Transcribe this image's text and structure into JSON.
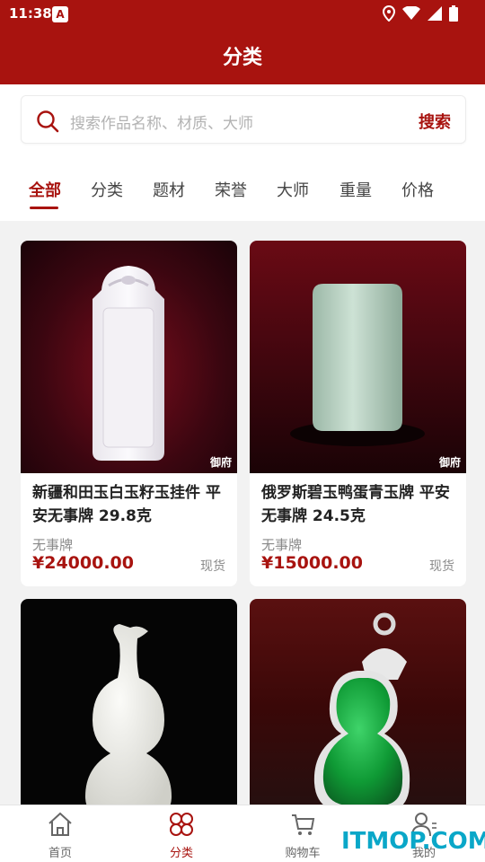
{
  "status_bar": {
    "time": "11:38",
    "app_icon_glyph": "A"
  },
  "header": {
    "title": "分类"
  },
  "search": {
    "placeholder": "搜索作品名称、材质、大师",
    "button": "搜索"
  },
  "tabs": [
    {
      "label": "全部",
      "active": true
    },
    {
      "label": "分类"
    },
    {
      "label": "题材"
    },
    {
      "label": "荣誉"
    },
    {
      "label": "大师"
    },
    {
      "label": "重量"
    },
    {
      "label": "价格"
    }
  ],
  "products": [
    {
      "name": "新疆和田玉白玉籽玉挂件 平安无事牌 29.8克",
      "category": "无事牌",
      "price": "¥24000.00",
      "stock": "现货",
      "watermark": "御府"
    },
    {
      "name": "俄罗斯碧玉鸭蛋青玉牌 平安无事牌 24.5克",
      "category": "无事牌",
      "price": "¥15000.00",
      "stock": "现货",
      "watermark": "御府"
    },
    {
      "name": "",
      "category": "",
      "price": "",
      "stock": ""
    },
    {
      "name": "",
      "category": "",
      "price": "",
      "stock": ""
    }
  ],
  "bottom_nav": [
    {
      "label": "首页",
      "icon": "home-icon"
    },
    {
      "label": "分类",
      "icon": "category-icon",
      "active": true
    },
    {
      "label": "购物车",
      "icon": "cart-icon"
    },
    {
      "label": "我的",
      "icon": "user-icon"
    }
  ],
  "overlay_watermark": "ITMOP.COM",
  "colors": {
    "brand_red": "#a8130f",
    "watermark_blue": "#0aa7c8"
  }
}
